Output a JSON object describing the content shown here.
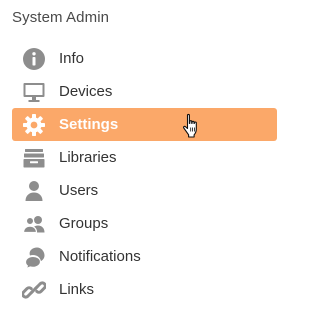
{
  "panel": {
    "title": "System Admin"
  },
  "nav": {
    "items": [
      {
        "label": "Info",
        "icon": "info-icon"
      },
      {
        "label": "Devices",
        "icon": "monitor-icon"
      },
      {
        "label": "Settings",
        "icon": "gear-icon",
        "active": true
      },
      {
        "label": "Libraries",
        "icon": "archive-icon"
      },
      {
        "label": "Users",
        "icon": "user-icon"
      },
      {
        "label": "Groups",
        "icon": "group-icon"
      },
      {
        "label": "Notifications",
        "icon": "chat-bubbles-icon"
      },
      {
        "label": "Links",
        "icon": "link-icon"
      }
    ]
  },
  "colors": {
    "active_bg": "#fba869",
    "icon_gray": "#8d8d8d",
    "active_text": "#ffffff",
    "text": "#333333"
  }
}
